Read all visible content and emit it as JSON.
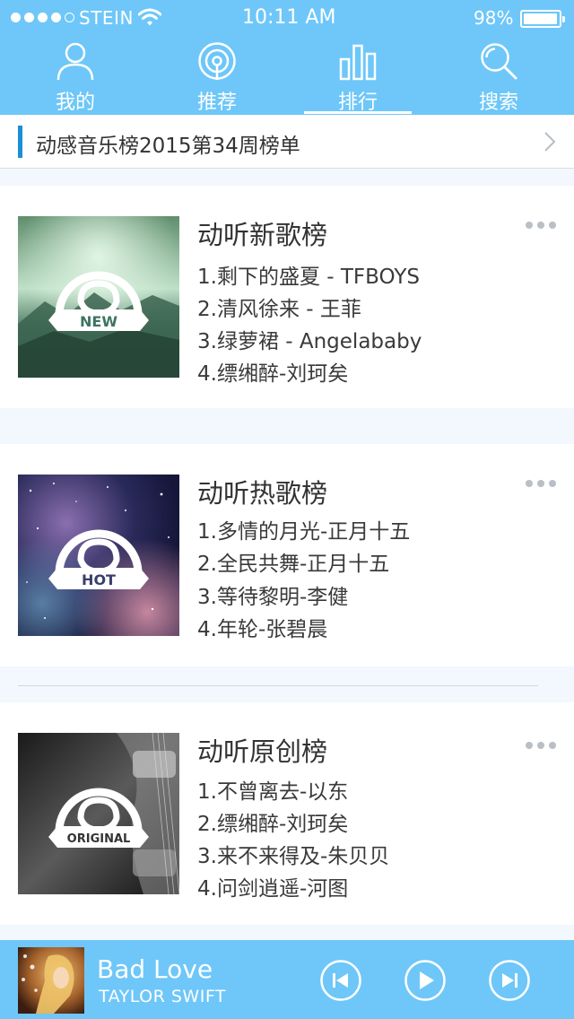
{
  "status_bar": {
    "carrier": "STEIN",
    "time": "10:11 AM",
    "battery_text": "98%",
    "battery_level": 0.98
  },
  "tabs": [
    {
      "label": "我的",
      "icon": "person-icon",
      "active": false
    },
    {
      "label": "推荐",
      "icon": "broadcast-icon",
      "active": false
    },
    {
      "label": "排行",
      "icon": "bar-chart-icon",
      "active": true
    },
    {
      "label": "搜索",
      "icon": "search-icon",
      "active": false
    }
  ],
  "week_banner": {
    "text": "动感音乐榜2015第34周榜单"
  },
  "charts": [
    {
      "title": "动听新歌榜",
      "badge": "NEW",
      "songs": [
        "1.剩下的盛夏 - TFBOYS",
        "2.清风徐来 - 王菲",
        "3.绿萝裙 - Angelababy",
        "4.缥缃醉-刘珂矣"
      ]
    },
    {
      "title": "动听热歌榜",
      "badge": "HOT",
      "songs": [
        "1.多情的月光-正月十五",
        "2.全民共舞-正月十五",
        "3.等待黎明-李健",
        "4.年轮-张碧晨"
      ]
    },
    {
      "title": "动听原创榜",
      "badge": "ORIGINAL",
      "songs": [
        "1.不曾离去-以东",
        "2.缥缃醉-刘珂矣",
        "3.来不来得及-朱贝贝",
        "4.问剑逍遥-河图"
      ]
    }
  ],
  "player": {
    "song": "Bad Love",
    "artist": "TAYLOR SWIFT",
    "colors": {
      "bar": "#6ec7f8",
      "accent": "#1a8fd6"
    }
  }
}
